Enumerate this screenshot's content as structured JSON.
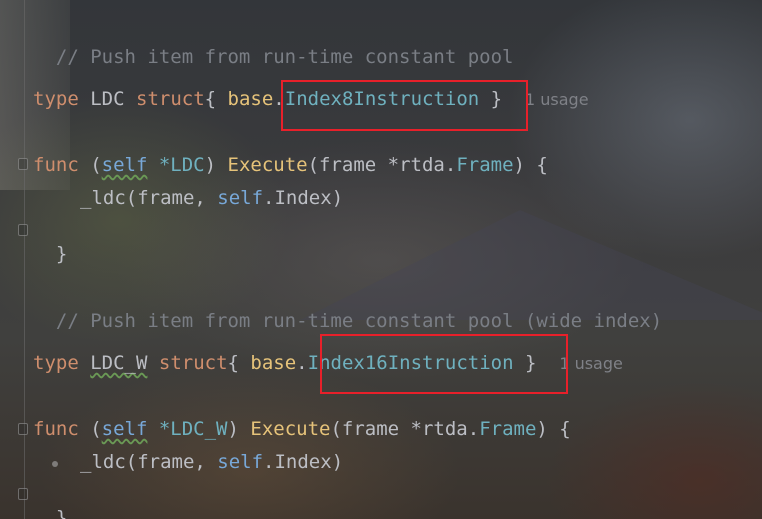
{
  "editor": {
    "lines": [
      {
        "comment": "// Push item from run-time constant pool"
      },
      {
        "kw_type": "type",
        "name": "LDC",
        "kw_struct": "struct",
        "brace_open": "{ ",
        "pkg": "base",
        "dot": ".",
        "embedded": "Index8Instruction",
        "brace_close": " }",
        "usage": "1 usage"
      },
      {
        "kw_func": "func",
        "paren_open": " (",
        "self": "self",
        "receiver_type": " *LDC",
        "paren_close": ") ",
        "method": "Execute",
        "params_open": "(frame *",
        "pkg": "rtda",
        "dot": ".",
        "param_type": "Frame",
        "params_close": ") {"
      },
      {
        "call": "_ldc",
        "args_open": "(frame, ",
        "self": "self",
        "field": ".Index",
        "args_close": ")"
      },
      {
        "close": "}"
      },
      {
        "comment": "// Push item from run-time constant pool (wide index)"
      },
      {
        "kw_type": "type",
        "name": "LDC_W",
        "kw_struct": "struct",
        "brace_open": "{ ",
        "pkg": "base",
        "dot": ".",
        "embedded": "Index16Instruction",
        "brace_close": " }",
        "usage": "1 usage"
      },
      {
        "kw_func": "func",
        "paren_open": " (",
        "self": "self",
        "receiver_type": " *LDC_W",
        "paren_close": ") ",
        "method": "Execute",
        "params_open": "(frame *",
        "pkg": "rtda",
        "dot": ".",
        "param_type": "Frame",
        "params_close": ") {"
      },
      {
        "call": "_ldc",
        "args_open": "(frame, ",
        "self": "self",
        "field": ".Index",
        "args_close": ")"
      },
      {
        "close": "}"
      }
    ]
  },
  "colors": {
    "highlight_box": "#e8202a",
    "keyword": "#cf8e6d",
    "comment": "#7a7e85",
    "function": "#e6c37a",
    "type_ref": "#6fb1bf"
  }
}
